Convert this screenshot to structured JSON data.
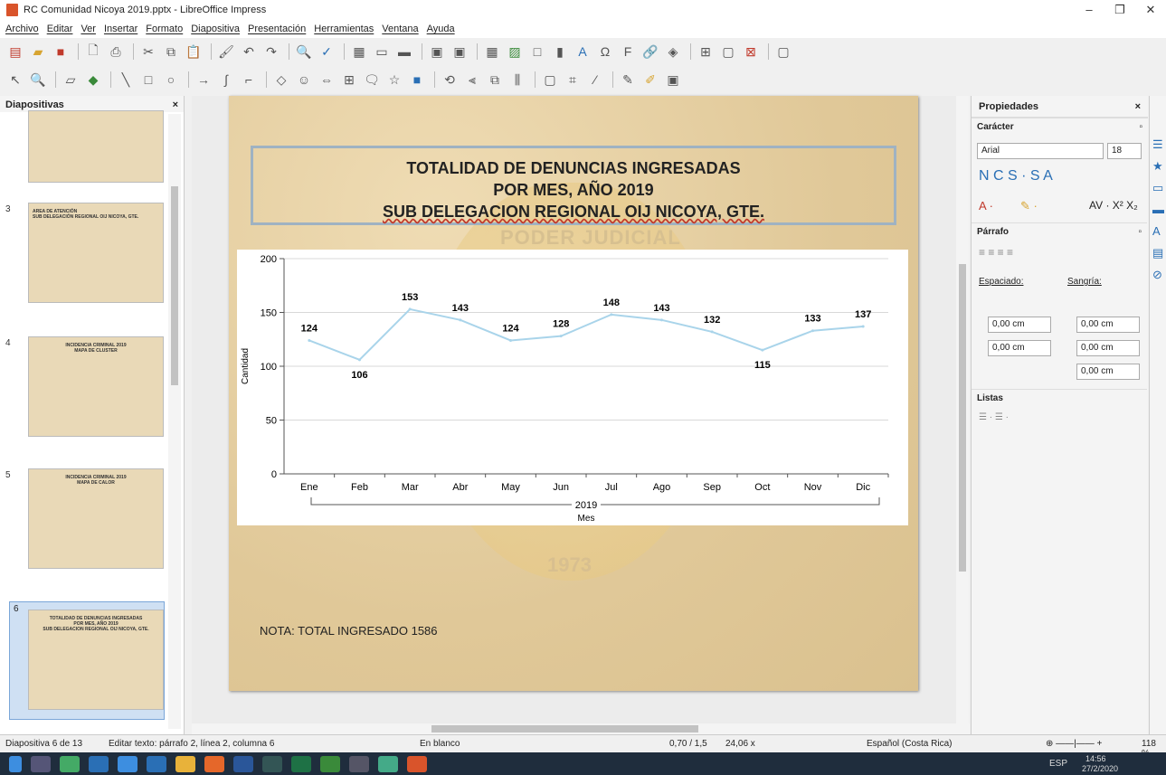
{
  "window": {
    "title": "RC Comunidad Nicoya 2019.pptx - LibreOffice Impress",
    "controls": [
      "–",
      "❐",
      "✕"
    ]
  },
  "menu": [
    "Archivo",
    "Editar",
    "Ver",
    "Insertar",
    "Formato",
    "Diapositiva",
    "Presentación",
    "Herramientas",
    "Ventana",
    "Ayuda"
  ],
  "slides_panel": {
    "title": "Diapositivas",
    "close": "×",
    "thumbs": [
      {
        "num": "3",
        "text": "AREA DE ATENCIÓN\nSUB DELEGACIÓN REGIONAL OIJ NICOYA, GTE."
      },
      {
        "num": "4",
        "text": "INCIDENCIA CRIMINAL 2019\nMAPA DE CLUSTER"
      },
      {
        "num": "5",
        "text": "INCIDENCIA CRIMINAL 2019\nMAPA DE CALOR"
      },
      {
        "num": "6",
        "text": "TOTALIDAD DE DENUNCIAS INGRESADAS\nPOR MES, AÑO 2019\nSUB DELEGACION REGIONAL OIJ NICOYA, GTE."
      }
    ]
  },
  "slide": {
    "title1": "TOTALIDAD DE DENUNCIAS INGRESADAS",
    "title2": "POR MES, AÑO 2019",
    "title3": "SUB DELEGACION REGIONAL OIJ NICOYA, GTE.",
    "seal_text": "PODER JUDICIAL",
    "seal_year": "1973",
    "nota": "NOTA: TOTAL INGRESADO 1586"
  },
  "chart_data": {
    "type": "line",
    "categories": [
      "Ene",
      "Feb",
      "Mar",
      "Abr",
      "May",
      "Jun",
      "Jul",
      "Ago",
      "Sep",
      "Oct",
      "Nov",
      "Dic"
    ],
    "values": [
      124,
      106,
      153,
      143,
      124,
      128,
      148,
      143,
      132,
      115,
      133,
      137
    ],
    "ylabel": "Cantidad",
    "xgroup": "2019",
    "xlabel": "Mes",
    "ylim": [
      0,
      200
    ],
    "yticks": [
      0,
      50,
      100,
      150,
      200
    ],
    "line_color": "#a9d4ea",
    "grid": true
  },
  "properties": {
    "title": "Propiedades",
    "close": "×",
    "caracter": "Carácter",
    "font": "Arial",
    "size": "18",
    "parrafo": "Párrafo",
    "espaciado": "Espaciado:",
    "sangria": "Sangría:",
    "sp_above": "0,00 cm",
    "sp_below": "0,00 cm",
    "ind_before": "0,00 cm",
    "ind_after": "0,00 cm",
    "ind_first": "0,00 cm",
    "listas": "Listas"
  },
  "status": {
    "slide": "Diapositiva 6 de 13",
    "edit": "Editar texto: párrafo 2, línea 2, columna 6",
    "layout": "En blanco",
    "pos": "0,70 / 1,5",
    "size": "24,06 x",
    "lang": "Español (Costa Rica)",
    "zoom": "118 %"
  },
  "taskbar": {
    "lang": "ESP",
    "time": "14:56",
    "date": "27/2/2020"
  }
}
